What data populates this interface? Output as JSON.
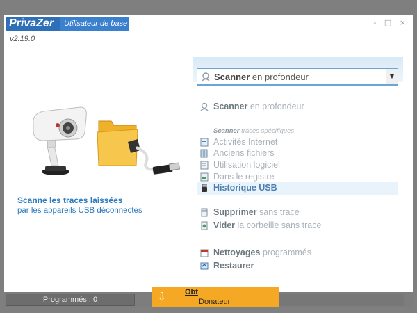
{
  "app": {
    "logo": "PrivaZer",
    "subtitle": "Utilisateur de base",
    "version": "v2.19.0",
    "window_controls": "- □ ×"
  },
  "hero": {
    "title": "Scanne les traces laissées",
    "subtitle": "par les appareils USB déconnectés"
  },
  "dropdown": {
    "selected_bold": "Scanner",
    "selected_rest": " en profondeur",
    "options": [
      {
        "bold": "Scanner",
        "rest": " en profondeur",
        "icon": "deep-scan-icon"
      },
      {
        "section_bold": "Scanner",
        "section_rest": " traces spécifiques"
      },
      {
        "bold": "",
        "rest": "Activités Internet",
        "icon": "internet-icon"
      },
      {
        "bold": "",
        "rest": "Anciens fichiers",
        "icon": "old-files-icon"
      },
      {
        "bold": "",
        "rest": "Utilisation logiciel",
        "icon": "software-icon"
      },
      {
        "bold": "",
        "rest": "Dans le registre",
        "icon": "registry-icon"
      },
      {
        "bold": "Historique USB",
        "rest": "",
        "icon": "usb-icon",
        "highlighted": true
      },
      {
        "bold": "Supprimer",
        "rest": " sans trace",
        "icon": "delete-icon"
      },
      {
        "bold": "Vider",
        "rest": " la corbeille sans trace",
        "icon": "recycle-bin-icon"
      },
      {
        "bold": "Nettoyages",
        "rest": " programmés",
        "icon": "calendar-icon"
      },
      {
        "bold": "Restaurer",
        "rest": "",
        "icon": "restore-icon"
      }
    ]
  },
  "statusbar": {
    "programmes": "Programmés : 0",
    "donor_line1": "Obt",
    "donor_line2": "Donateur"
  },
  "colors": {
    "accent": "#2b7bc0",
    "logo_bg": "#2f6fb8",
    "donor": "#f5a823"
  }
}
